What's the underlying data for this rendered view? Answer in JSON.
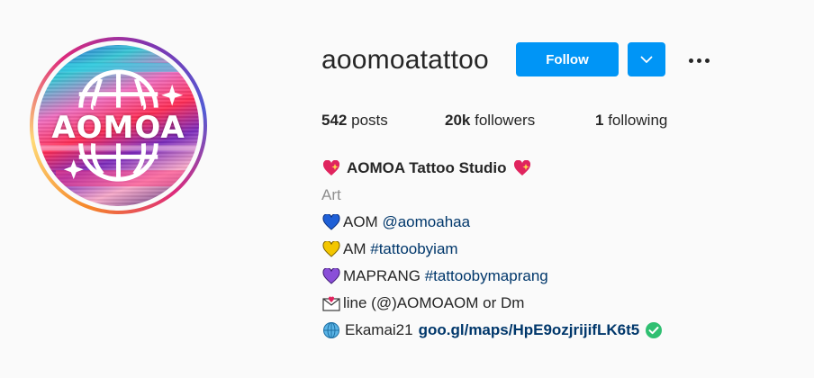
{
  "profile": {
    "username": "aoomoatattoo",
    "follow_label": "Follow",
    "avatar_text": "AOMOA",
    "stats": {
      "posts_count": "542",
      "posts_label": "posts",
      "followers_count": "20k",
      "followers_label": "followers",
      "following_count": "1",
      "following_label": "following"
    },
    "bio": {
      "name": "AOMOA Tattoo Studio",
      "category": "Art",
      "lines": [
        {
          "text": "AOM ",
          "link": "@aomoahaa",
          "emoji": "blue-heart-icon",
          "color": "#1e5fd6"
        },
        {
          "text": "AM ",
          "link": "#tattoobyiam",
          "emoji": "yellow-heart-icon",
          "color": "#f3c600"
        },
        {
          "text": "MAPRANG ",
          "link": "#tattoobymaprang",
          "emoji": "purple-heart-icon",
          "color": "#8a4fd8"
        }
      ],
      "contact": "line (@)AOMOAOM or Dm",
      "location": "Ekamai21",
      "website": "goo.gl/maps/HpE9ozjrijifLK6t5"
    }
  },
  "colors": {
    "accent": "#0095f6",
    "link": "#00376b",
    "muted": "#8e8e8e",
    "verified_green": "#2fbf71"
  }
}
